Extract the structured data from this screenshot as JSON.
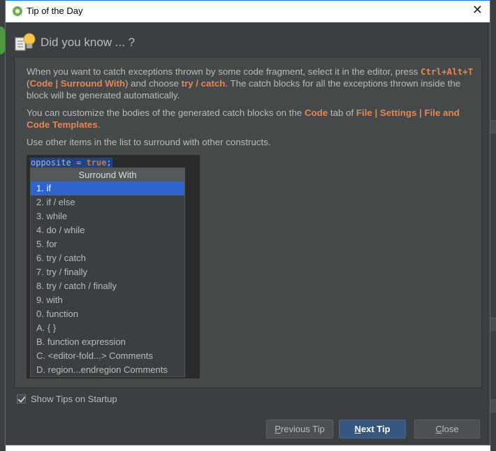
{
  "window": {
    "title": "Tip of the Day",
    "close_glyph": "✕"
  },
  "header": {
    "title": "Did you know ... ?",
    "icon": "lightbulb-icon"
  },
  "tip": {
    "p1_a": "When you want to catch exceptions thrown by some code fragment, select it in the editor, press ",
    "p1_shortcut": "Ctrl+Alt+T",
    "p1_b": " (",
    "p1_menu": "Code | Surround With",
    "p1_c": ") and choose ",
    "p1_choice": "try / catch",
    "p1_d": ". The catch blocks for all the exceptions thrown inside the block will be generated automatically.",
    "p2_a": "You can customize the bodies of the generated catch blocks on the ",
    "p2_tab": "Code",
    "p2_b": " tab of ",
    "p2_path": "File | Settings | File and Code Templates",
    "p2_c": ".",
    "p3": "Use other items in the list to surround with other constructs."
  },
  "editor": {
    "code_var": "opposite",
    "code_eq": " = ",
    "code_val": "true",
    "code_end": ";",
    "popup_title": "Surround With",
    "items": [
      "1. if",
      "2. if / else",
      "3. while",
      "4. do / while",
      "5. for",
      "6. try / catch",
      "7. try / finally",
      "8. try / catch / finally",
      "9. with",
      "0. function",
      "A. { }",
      "B. function expression",
      "C. <editor-fold...> Comments",
      "D. region...endregion Comments"
    ],
    "selected_index": 0
  },
  "footer": {
    "show_tips_label": "Show Tips on Startup",
    "show_tips_checked": true,
    "prev_label_mnemonic": "P",
    "prev_label_rest": "revious Tip",
    "next_label_mnemonic": "N",
    "next_label_rest": "ext Tip",
    "close_label_mnemonic": "C",
    "close_label_rest": "lose"
  },
  "colors": {
    "accent_orange": "#e8864f",
    "selection_blue": "#2f65ca",
    "dialog_bg": "#3c3f41"
  }
}
